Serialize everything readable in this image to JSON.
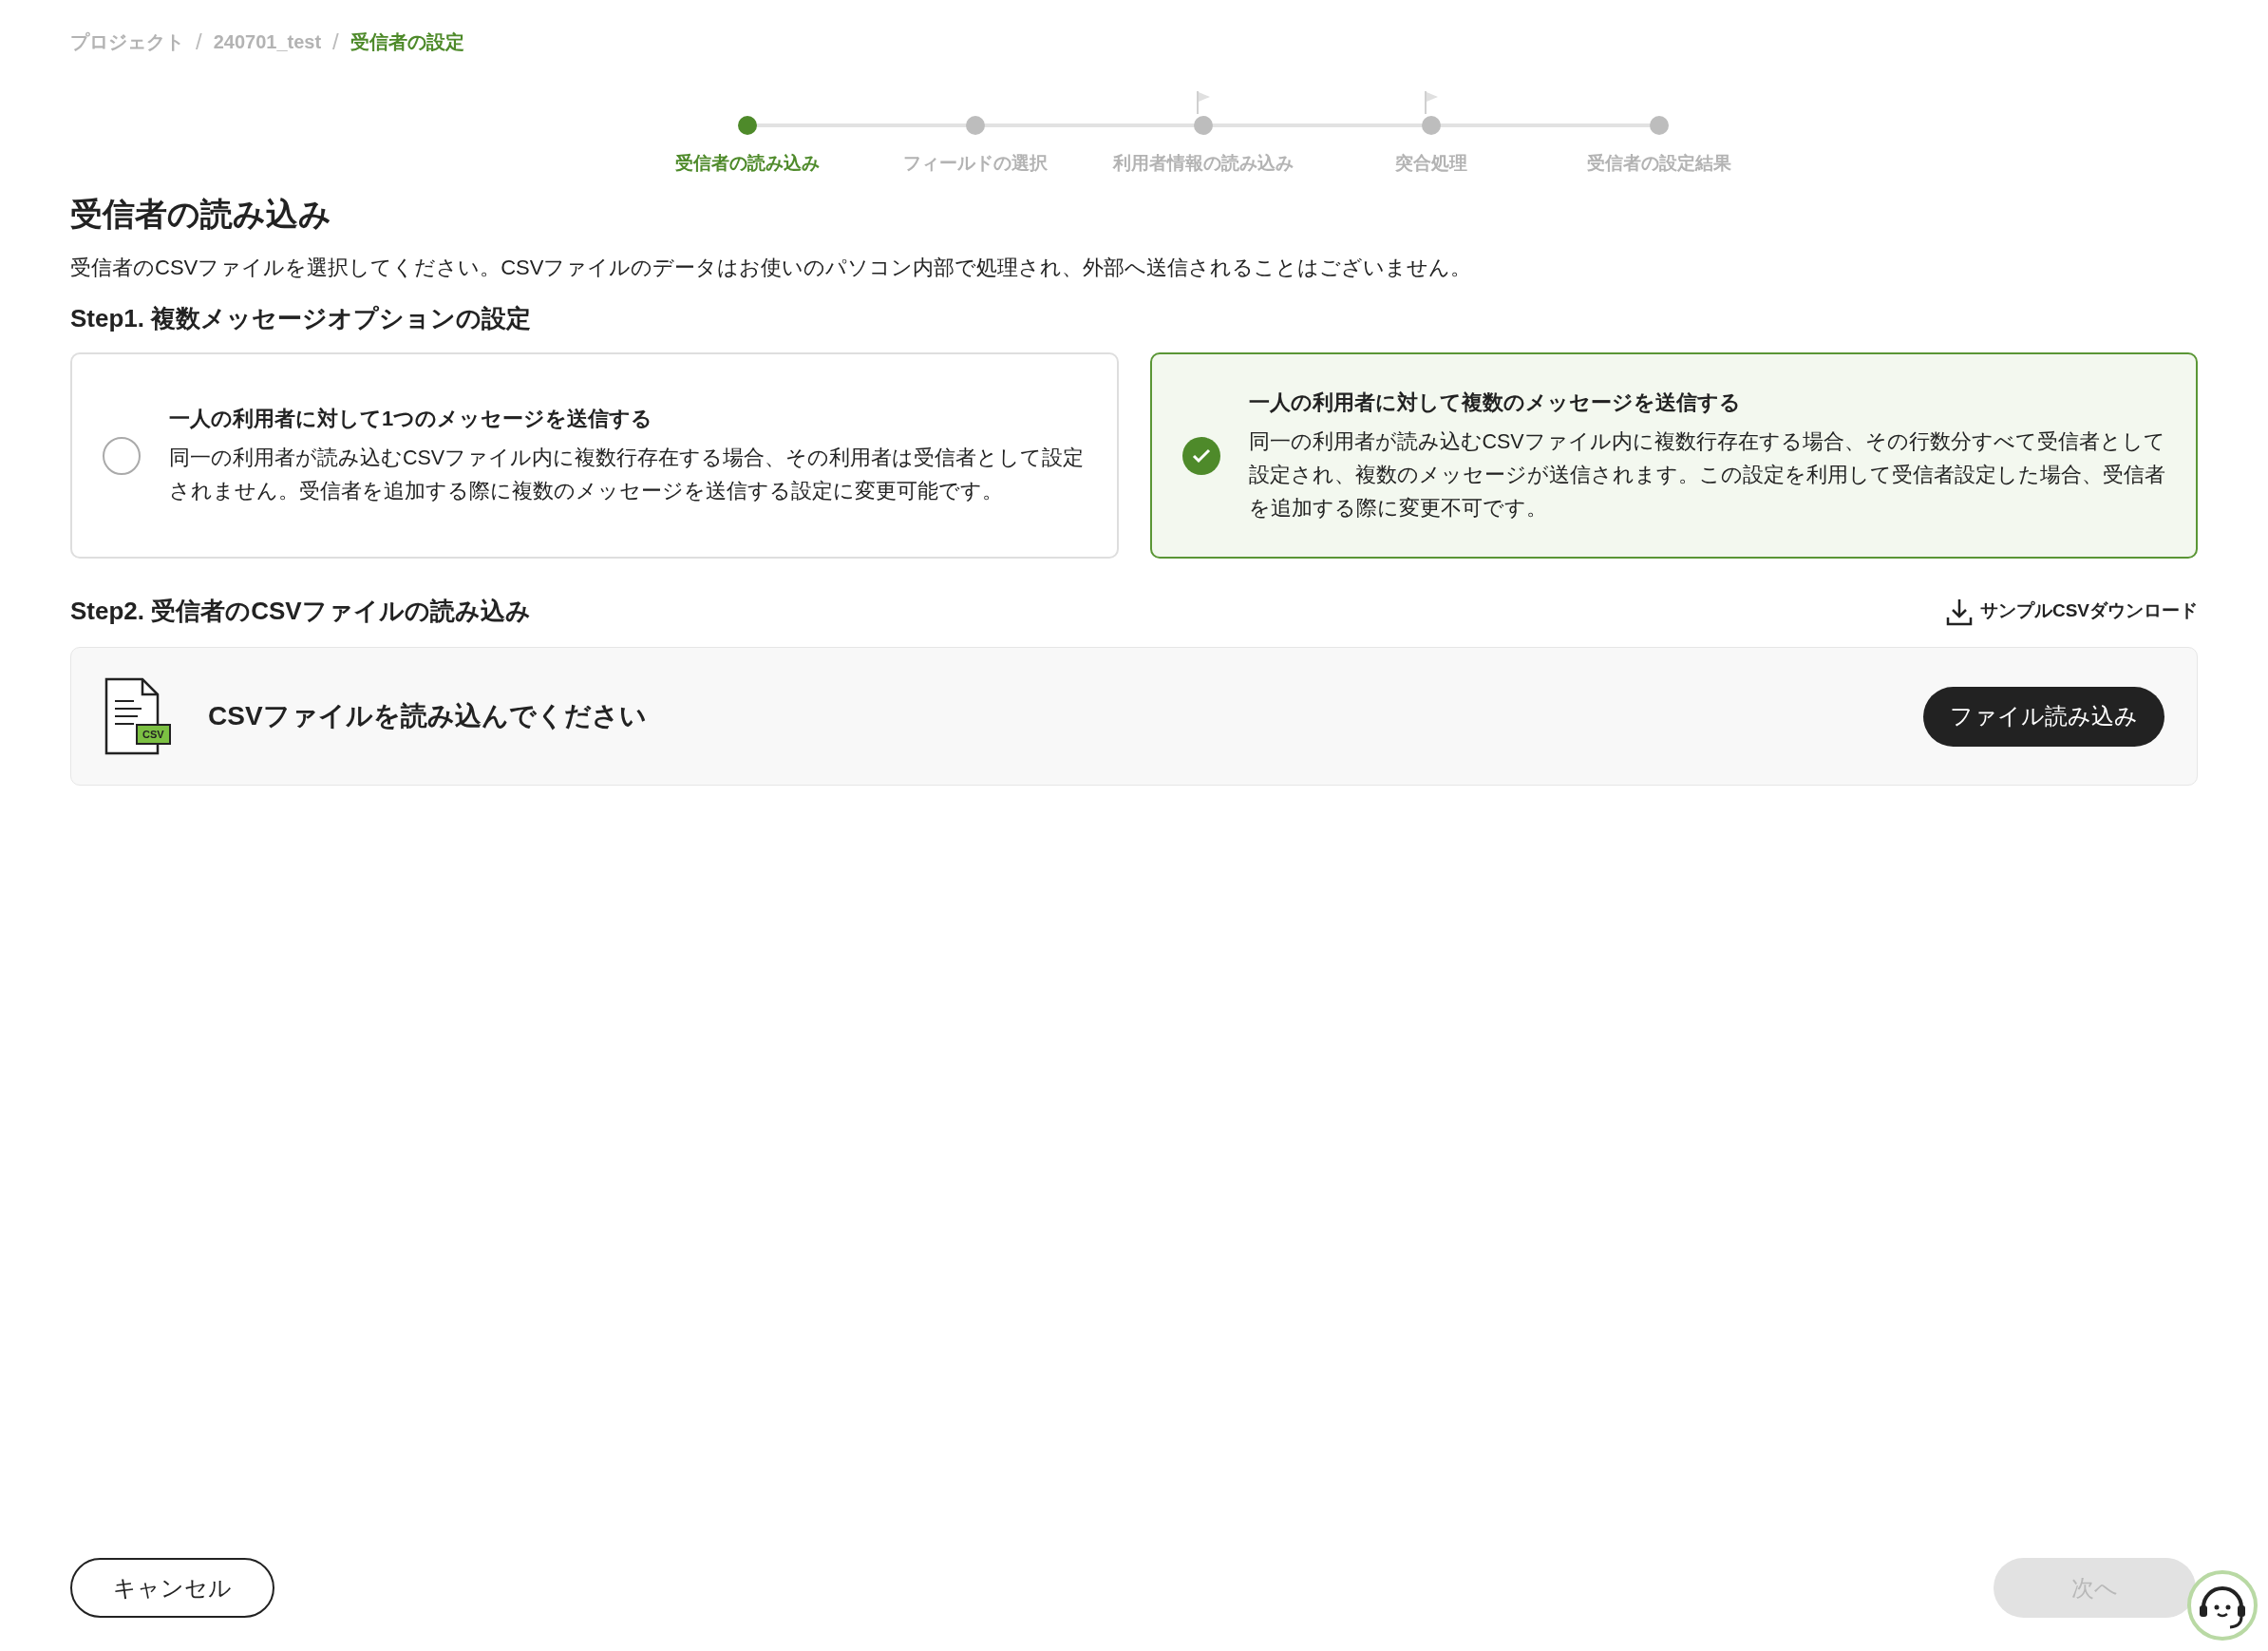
{
  "breadcrumb": [
    {
      "label": "プロジェクト",
      "current": false
    },
    {
      "label": "240701_test",
      "current": false
    },
    {
      "label": "受信者の設定",
      "current": true
    }
  ],
  "separator": "/",
  "stepper": [
    {
      "label": "受信者の読み込み",
      "selected": true,
      "flag": false
    },
    {
      "label": "フィールドの選択",
      "selected": false,
      "flag": false
    },
    {
      "label": "利用者情報の読み込み",
      "selected": false,
      "flag": true
    },
    {
      "label": "突合処理",
      "selected": false,
      "flag": true
    },
    {
      "label": "受信者の設定結果",
      "selected": false,
      "flag": false
    }
  ],
  "title": "受信者の読み込み",
  "description": "受信者のCSVファイルを選択してください。CSVファイルのデータはお使いのパソコン内部で処理され、外部へ送信されることはございません。",
  "step1": {
    "heading": "Step1. 複数メッセージオプションの設定",
    "options": [
      {
        "title": "一人の利用者に対して1つのメッセージを送信する",
        "body": "同一の利用者が読み込むCSVファイル内に複数行存在する場合、その利用者は受信者として設定されません。受信者を追加する際に複数のメッセージを送信する設定に変更可能です。",
        "selected": false
      },
      {
        "title": "一人の利用者に対して複数のメッセージを送信する",
        "body": "同一の利用者が読み込むCSVファイル内に複数行存在する場合、その行数分すべて受信者として設定され、複数のメッセージが送信されます。この設定を利用して受信者設定した場合、受信者を追加する際に変更不可です。",
        "selected": true
      }
    ]
  },
  "step2": {
    "heading": "Step2. 受信者のCSVファイルの読み込み",
    "download_link": "サンプルCSVダウンロード",
    "file_badge": "CSV",
    "prompt": "CSVファイルを読み込んでください",
    "button": "ファイル読み込み"
  },
  "footer": {
    "cancel": "キャンセル",
    "next": {
      "label": "次へ",
      "disabled": true
    }
  }
}
